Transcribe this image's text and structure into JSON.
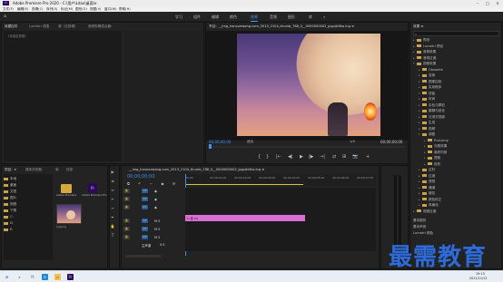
{
  "app": {
    "title": "Adobe Premiere Pro 2020 - C:\\用户\\Ldao\\桌面\\e",
    "icon_label": "Pr",
    "window_controls": {
      "minimize": "–",
      "maximize": "□",
      "close": "✕"
    }
  },
  "menu": [
    "文件(F)",
    "编辑(E)",
    "剪辑(C)",
    "序列(S)",
    "标记(M)",
    "图形(G)",
    "视图(V)",
    "窗口(W)",
    "帮助(H)"
  ],
  "workspaces": {
    "home_icon": "home-icon",
    "items": [
      "学习",
      "组件",
      "编辑",
      "颜色",
      "效果",
      "音频",
      "图形",
      "库"
    ],
    "active": "效果",
    "menu_glyph": "»"
  },
  "effect_controls": {
    "tabs": [
      "效果控件",
      "Lumetri 范围",
      "源（无剪辑）",
      "音频剪辑混合器:"
    ],
    "source_label": "（未选定剪辑）"
  },
  "program_monitor": {
    "tab": "节目：__img_hanxuewang.com_2013_2104_thumb_788_0__0000000002_jpgzjkl4ko.ing ≡",
    "timecode_left": "00;00;00;00",
    "fit": "适合",
    "quality": "1/4",
    "timecode_right": "00;00;00;00",
    "controls": [
      "{",
      "}",
      "|←",
      "◀|",
      "▶",
      "|▶",
      "→|",
      "⇄",
      "⊞",
      "📷",
      "+"
    ]
  },
  "effects_panel": {
    "title": "效果 ≡",
    "search_placeholder": "",
    "tree": [
      {
        "label": "预设",
        "depth": 0,
        "expanded": false
      },
      {
        "label": "Lumetri 预设",
        "depth": 0,
        "expanded": false
      },
      {
        "label": "音频效果",
        "depth": 0,
        "expanded": false
      },
      {
        "label": "音频过渡",
        "depth": 0,
        "expanded": false
      },
      {
        "label": "视频效果",
        "depth": 0,
        "expanded": true
      },
      {
        "label": "Obsolete",
        "depth": 1,
        "expanded": false
      },
      {
        "label": "变换",
        "depth": 1,
        "expanded": false
      },
      {
        "label": "图像控制",
        "depth": 1,
        "expanded": false
      },
      {
        "label": "实用程序",
        "depth": 1,
        "expanded": false
      },
      {
        "label": "扭曲",
        "depth": 1,
        "expanded": true
      },
      {
        "label": "时间",
        "depth": 1,
        "expanded": false
      },
      {
        "label": "杂色与颗粒",
        "depth": 1,
        "expanded": false
      },
      {
        "label": "模糊与锐化",
        "depth": 1,
        "expanded": false
      },
      {
        "label": "沉浸式视频",
        "depth": 1,
        "expanded": false
      },
      {
        "label": "生成",
        "depth": 1,
        "expanded": false
      },
      {
        "label": "视频",
        "depth": 1,
        "expanded": false
      },
      {
        "label": "调整",
        "depth": 1,
        "expanded": true
      },
      {
        "label": "ProcAmp",
        "depth": 2,
        "expanded": false
      },
      {
        "label": "光照效果",
        "depth": 2,
        "expanded": false
      },
      {
        "label": "卷积内核",
        "depth": 2,
        "expanded": false
      },
      {
        "label": "提取",
        "depth": 2,
        "expanded": false
      },
      {
        "label": "色阶",
        "depth": 2,
        "expanded": false
      },
      {
        "label": "过时",
        "depth": 1,
        "expanded": false
      },
      {
        "label": "过渡",
        "depth": 1,
        "expanded": false
      },
      {
        "label": "透视",
        "depth": 1,
        "expanded": false
      },
      {
        "label": "通道",
        "depth": 1,
        "expanded": false
      },
      {
        "label": "键控",
        "depth": 1,
        "expanded": false
      },
      {
        "label": "颜色校正",
        "depth": 1,
        "expanded": false
      },
      {
        "label": "风格化",
        "depth": 1,
        "expanded": false
      },
      {
        "label": "视频过渡",
        "depth": 0,
        "expanded": false
      }
    ],
    "footer": [
      "基本图形",
      "基本声音",
      "Lumetri 颜色"
    ]
  },
  "project_panel": {
    "tabs": [
      "项目：e",
      "媒体浏览器",
      "库",
      "信息"
    ],
    "thumbs": [
      {
        "label": "Adobe Premiere",
        "kind": "folder"
      },
      {
        "label": "Adobe Premiere Pro",
        "kind": "pr"
      },
      {
        "label": "e.prproj",
        "kind": "image"
      }
    ],
    "media_tree": [
      "本地",
      "桌面",
      "文档",
      "图片",
      "视频",
      "下载",
      "C:",
      "D:",
      "E:"
    ]
  },
  "timeline": {
    "tab": "__img_hanxuewang.com_2013_2104_thumb_788_0__0000000002_jpgzjkl4ko.ing ≡",
    "timecode": "00;00;00;00",
    "ruler": [
      "00;00",
      "00;00;01;00",
      "00;00;02;00",
      "00;00;03;00",
      "00;00;04;00",
      "00;00;05;00",
      "00;00;06;00",
      "00;00;07;00"
    ],
    "video_tracks": [
      "V3",
      "V2",
      "V1"
    ],
    "audio_tracks": [
      "A1",
      "A2",
      "A3"
    ],
    "master": "主声道",
    "master_value": "0.0",
    "clip_label": "fx 图 [V]"
  },
  "tools": [
    "▶",
    "⇉",
    "⇔",
    "✂",
    "⇿",
    "✒",
    "✋",
    "T"
  ],
  "taskbar": {
    "time": "19:13",
    "date": "2021/11/12",
    "icons": [
      "windows-icon",
      "search-icon",
      "task-view-icon",
      "edge-icon",
      "explorer-icon",
      "premiere-icon"
    ]
  },
  "watermark": "最需教育"
}
